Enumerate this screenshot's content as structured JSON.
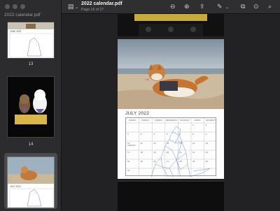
{
  "sidebar": {
    "title": "2022 calendar.pdf",
    "thumbs": [
      {
        "label": "13",
        "month": "JUNE 2022"
      },
      {
        "label": "14"
      },
      {
        "label": "",
        "month": "JULY 2022"
      }
    ]
  },
  "toolbar": {
    "title": "2022 calendar.pdf",
    "page_info": "Page 15 of 27",
    "icons": [
      "sidebar-toggle-icon",
      "zoom-out-icon",
      "zoom-in-icon",
      "share-icon",
      "markup-icon",
      "rotate-icon",
      "annotate-icon",
      "search-icon"
    ]
  },
  "calendar": {
    "month": "JULY 2022",
    "weekdays": [
      "SUNDAY",
      "MONDAY",
      "TUESDAY",
      "WEDNESDAY",
      "THURSDAY",
      "FRIDAY",
      "SATURDAY"
    ],
    "rows": [
      [
        "",
        "",
        "",
        "",
        "",
        "1",
        "2"
      ],
      [
        "3",
        "4",
        "5",
        "6",
        "7",
        "8",
        "9"
      ],
      [
        "10",
        "11",
        "12",
        "13",
        "14",
        "15",
        "16"
      ],
      [
        "17",
        "18",
        "19",
        "20",
        "21",
        "22",
        "23"
      ],
      [
        "24",
        "25",
        "26",
        "27",
        "28",
        "29",
        "30"
      ],
      [
        "31",
        "",
        "",
        "",
        "",
        "",
        ""
      ]
    ],
    "note": "JAMMIE'S"
  },
  "colors": {
    "window_bg": "#1f1f21",
    "sidebar_bg": "#2c2c2e",
    "accent": "#5d7fbf"
  }
}
